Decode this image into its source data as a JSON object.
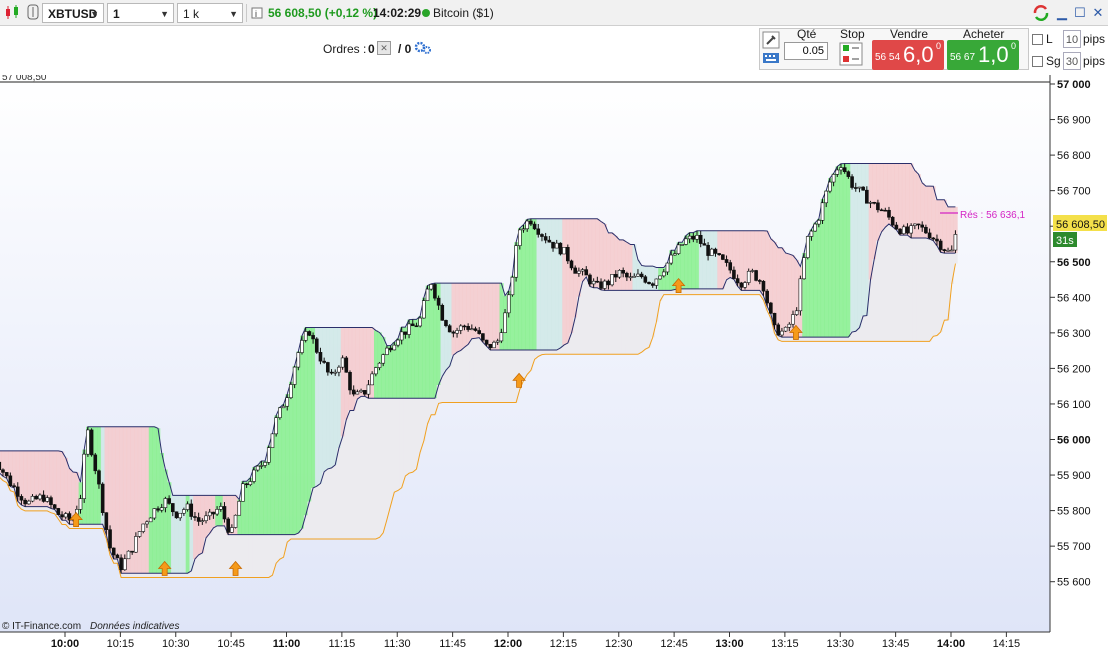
{
  "toolbar": {
    "symbol": "XBTUSD",
    "timeframe": "1 minute",
    "units": "1 k unités",
    "price_change": "56 608,50 (+0,12 %)",
    "time": "14:02:29",
    "instrument": "Bitcoin ($1)",
    "status_color": "#2aa52a"
  },
  "orders": {
    "label": "Ordres :",
    "count_a": "0",
    "count_b": "/ 0"
  },
  "trade_panel": {
    "qty_label": "Qté",
    "qty_value": "0.05",
    "stop_label": "Stop",
    "sell_label": "Vendre",
    "sell_small": "56 54",
    "sell_big": "6,0",
    "sell_sup": "0",
    "buy_label": "Acheter",
    "buy_small": "56 67",
    "buy_big": "1,0",
    "buy_sup": "0",
    "l_label": "L",
    "l_value": "10",
    "sg_label": "Sg",
    "sg_value": "30",
    "pips": "pips",
    "sell_color": "#e04848",
    "buy_color": "#38a838"
  },
  "chart": {
    "top_label": "57 008,50",
    "current_price": "56 608,50",
    "countdown": "31s",
    "resistance": "Rés : 56 636,1",
    "credit": "© IT-Finance.com",
    "credit_note": "Données indicatives"
  },
  "chart_data": {
    "type": "candlestick",
    "y_ticks": [
      "57 000",
      "56 900",
      "56 800",
      "56 700",
      "56 600",
      "56 500",
      "56 400",
      "56 300",
      "56 200",
      "56 100",
      "56 000",
      "55 900",
      "55 800",
      "55 700",
      "55 600"
    ],
    "ylim": [
      55580,
      57010
    ],
    "x_ticks": [
      {
        "label": "10:00",
        "bold": true
      },
      {
        "label": "10:15",
        "bold": false
      },
      {
        "label": "10:30",
        "bold": false
      },
      {
        "label": "10:45",
        "bold": false
      },
      {
        "label": "11:00",
        "bold": true
      },
      {
        "label": "11:15",
        "bold": false
      },
      {
        "label": "11:30",
        "bold": false
      },
      {
        "label": "11:45",
        "bold": false
      },
      {
        "label": "12:00",
        "bold": true
      },
      {
        "label": "12:15",
        "bold": false
      },
      {
        "label": "12:30",
        "bold": false
      },
      {
        "label": "12:45",
        "bold": false
      },
      {
        "label": "13:00",
        "bold": true
      },
      {
        "label": "13:15",
        "bold": false
      },
      {
        "label": "13:30",
        "bold": false
      },
      {
        "label": "13:45",
        "bold": false
      },
      {
        "label": "14:00",
        "bold": true
      },
      {
        "label": "14:15",
        "bold": false
      }
    ],
    "close_path": [
      [
        9.67,
        55960
      ],
      [
        9.75,
        55880
      ],
      [
        9.83,
        55820
      ],
      [
        9.9,
        55840
      ],
      [
        9.97,
        55790
      ],
      [
        10.03,
        55770
      ],
      [
        10.07,
        55840
      ],
      [
        10.1,
        56030
      ],
      [
        10.15,
        55880
      ],
      [
        10.2,
        55700
      ],
      [
        10.25,
        55640
      ],
      [
        10.3,
        55690
      ],
      [
        10.35,
        55760
      ],
      [
        10.4,
        55800
      ],
      [
        10.45,
        55830
      ],
      [
        10.5,
        55790
      ],
      [
        10.55,
        55810
      ],
      [
        10.6,
        55770
      ],
      [
        10.65,
        55780
      ],
      [
        10.7,
        55810
      ],
      [
        10.75,
        55730
      ],
      [
        10.8,
        55860
      ],
      [
        10.85,
        55900
      ],
      [
        10.9,
        55940
      ],
      [
        10.95,
        56050
      ],
      [
        11.0,
        56120
      ],
      [
        11.05,
        56240
      ],
      [
        11.1,
        56310
      ],
      [
        11.13,
        56260
      ],
      [
        11.2,
        56170
      ],
      [
        11.25,
        56230
      ],
      [
        11.3,
        56120
      ],
      [
        11.35,
        56130
      ],
      [
        11.4,
        56200
      ],
      [
        11.45,
        56250
      ],
      [
        11.5,
        56290
      ],
      [
        11.55,
        56310
      ],
      [
        11.6,
        56330
      ],
      [
        11.65,
        56450
      ],
      [
        11.7,
        56350
      ],
      [
        11.75,
        56300
      ],
      [
        11.8,
        56320
      ],
      [
        11.85,
        56310
      ],
      [
        11.9,
        56260
      ],
      [
        11.95,
        56270
      ],
      [
        12.0,
        56380
      ],
      [
        12.05,
        56590
      ],
      [
        12.1,
        56620
      ],
      [
        12.15,
        56580
      ],
      [
        12.2,
        56550
      ],
      [
        12.25,
        56530
      ],
      [
        12.3,
        56480
      ],
      [
        12.35,
        56460
      ],
      [
        12.4,
        56430
      ],
      [
        12.45,
        56440
      ],
      [
        12.5,
        56470
      ],
      [
        12.55,
        56450
      ],
      [
        12.6,
        56460
      ],
      [
        12.65,
        56440
      ],
      [
        12.7,
        56480
      ],
      [
        12.75,
        56520
      ],
      [
        12.8,
        56560
      ],
      [
        12.85,
        56570
      ],
      [
        12.9,
        56530
      ],
      [
        12.95,
        56510
      ],
      [
        13.0,
        56480
      ],
      [
        13.05,
        56440
      ],
      [
        13.1,
        56470
      ],
      [
        13.15,
        56440
      ],
      [
        13.2,
        56310
      ],
      [
        13.25,
        56300
      ],
      [
        13.3,
        56360
      ],
      [
        13.35,
        56560
      ],
      [
        13.4,
        56620
      ],
      [
        13.45,
        56720
      ],
      [
        13.5,
        56780
      ],
      [
        13.55,
        56720
      ],
      [
        13.6,
        56690
      ],
      [
        13.65,
        56660
      ],
      [
        13.7,
        56640
      ],
      [
        13.75,
        56600
      ],
      [
        13.8,
        56580
      ],
      [
        13.85,
        56600
      ],
      [
        13.9,
        56580
      ],
      [
        13.95,
        56550
      ],
      [
        14.0,
        56520
      ],
      [
        14.03,
        56600
      ]
    ],
    "arrows_at": [
      10.05,
      10.45,
      10.77,
      12.05,
      12.77,
      13.3
    ]
  }
}
